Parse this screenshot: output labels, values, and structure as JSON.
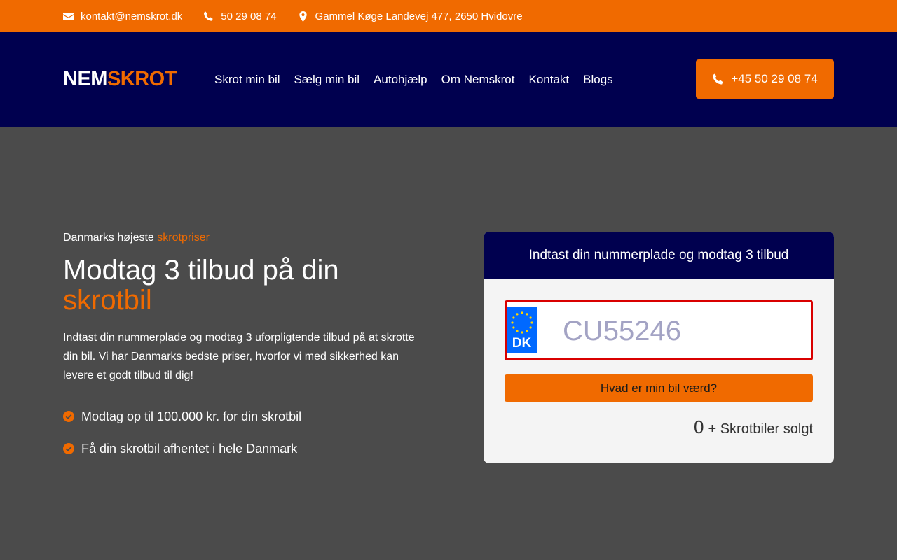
{
  "topbar": {
    "email": "kontakt@nemskrot.dk",
    "phone": "50 29 08 74",
    "address": "Gammel Køge Landevej 477, 2650 Hvidovre",
    "icons": [
      "envelope-icon",
      "phone-icon",
      "map-pin-icon"
    ]
  },
  "header": {
    "logo_a": "NEM",
    "logo_b": "SKROT",
    "nav": [
      "Skrot min bil",
      "Sælg min bil",
      "Autohjælp",
      "Om Nemskrot",
      "Kontakt",
      "Blogs"
    ],
    "cta_label": "+45 50 29 08 74"
  },
  "hero": {
    "eyebrow_prefix": "Danmarks højeste",
    "eyebrow_highlight": "skrotpriser",
    "title": "Modtag 3 tilbud på din",
    "title_highlight": "skrotbil",
    "lead": "Indtast din nummerplade og modtag 3 uforpligtende tilbud på at skrotte din bil. Vi har Danmarks bedste priser, hvorfor vi med sikkerhed kan levere et godt tilbud til dig!",
    "bullets": [
      "Modtag op til 100.000 kr. for din skrotbil",
      "Få din skrotbil afhentet i hele Danmark"
    ]
  },
  "form": {
    "heading": "Indtast din nummerplade og modtag 3 tilbud",
    "country_code": "DK",
    "plate_value": "",
    "plate_placeholder": "CU55246",
    "submit_label": "Hvad er min bil værd?",
    "sold_count": "0",
    "sold_label": "+ Skrotbiler solgt"
  },
  "colors": {
    "accent": "#f06a00",
    "navy": "#00004f",
    "background": "#4b4b4b",
    "error_border": "#d90000"
  }
}
